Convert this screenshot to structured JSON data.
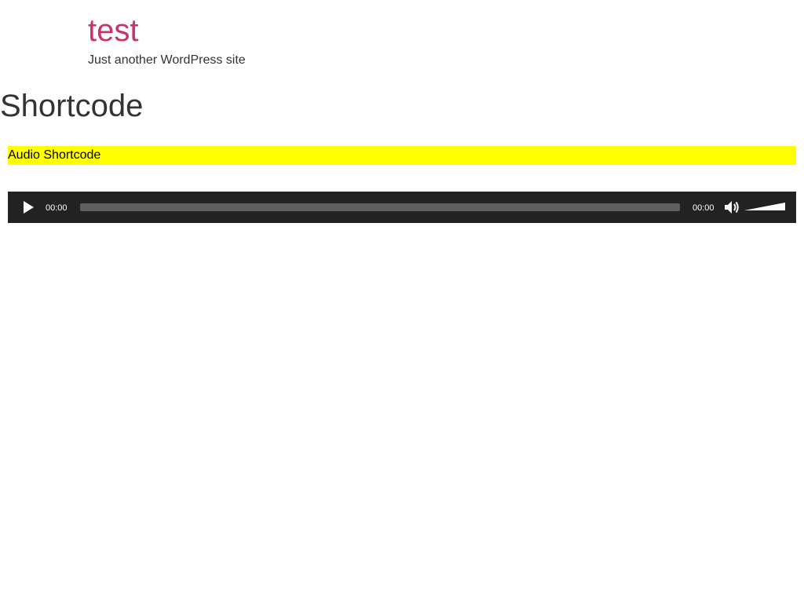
{
  "header": {
    "site_title": "test",
    "site_description": "Just another WordPress site"
  },
  "content": {
    "page_title": "Shortcode",
    "highlight_text": "Audio Shortcode"
  },
  "audio_player": {
    "current_time": "00:00",
    "duration": "00:00",
    "progress_fraction": 0,
    "volume_fraction": 1
  },
  "colors": {
    "title_accent": "#c7336b",
    "highlight": "#ffff00",
    "player_bg": "#222222"
  },
  "icons": {
    "play": "play-icon",
    "mute": "speaker-icon",
    "volume": "volume-slider-icon"
  }
}
